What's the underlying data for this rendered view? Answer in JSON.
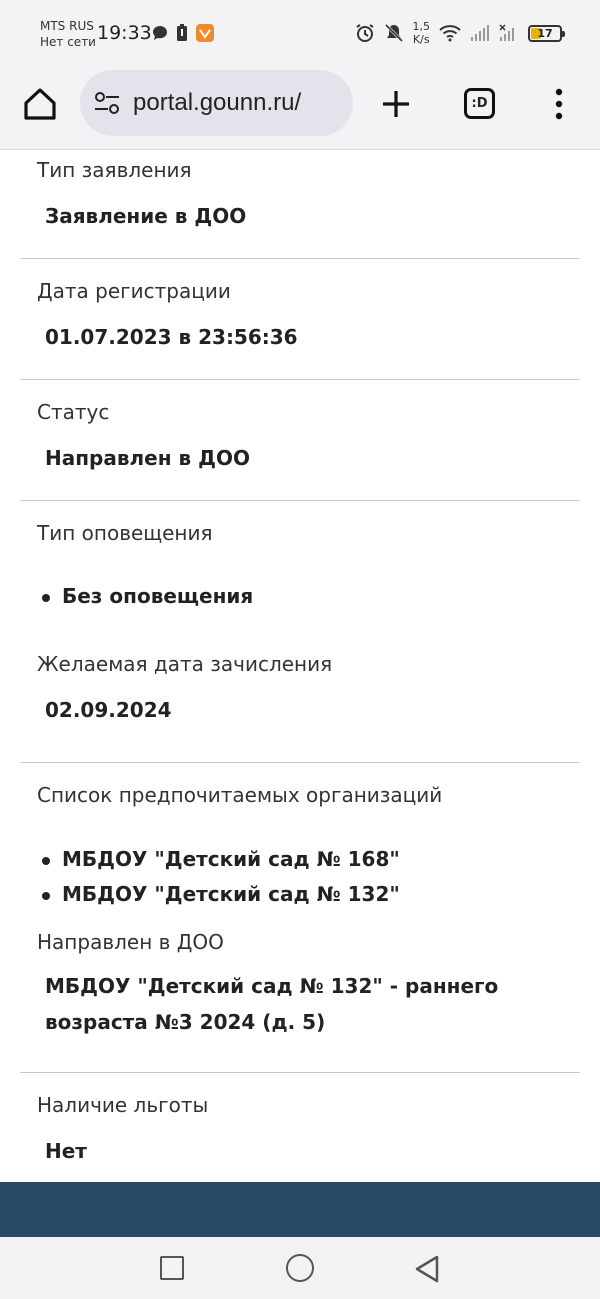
{
  "status_bar": {
    "carrier": "MTS RUS",
    "network": "Нет сети",
    "time": "19:33",
    "speed_value": "1,5",
    "speed_unit": "K/s",
    "battery": "17",
    "icons": [
      "chat-bubble-icon",
      "battery-saver-icon",
      "app-notification-icon",
      "alarm-icon",
      "mute-icon",
      "wifi-icon",
      "signal-icon",
      "signal-no-sim-icon"
    ]
  },
  "browser": {
    "url": "portal.gounn.ru/",
    "tabs_label": ":D",
    "icons": [
      "home-icon",
      "site-settings-icon",
      "new-tab-icon",
      "tabs-icon",
      "menu-icon"
    ]
  },
  "details": {
    "app_type": {
      "label": "Тип заявления",
      "value": "Заявление в ДОО"
    },
    "reg_date": {
      "label": "Дата регистрации",
      "value": "01.07.2023 в 23:56:36"
    },
    "status": {
      "label": "Статус",
      "value": "Направлен в ДОО"
    },
    "notify": {
      "label": "Тип оповещения",
      "items": [
        "Без оповещения"
      ]
    },
    "desired_date": {
      "label": "Желаемая дата зачисления",
      "value": "02.09.2024"
    },
    "orgs": {
      "label": "Список предпочитаемых организаций",
      "items": [
        "МБДОУ \"Детский сад № 168\"",
        "МБДОУ \"Детский сад № 132\""
      ]
    },
    "directed": {
      "label": "Направлен в ДОО",
      "value_line1": "МБДОУ \"Детский сад № 132\" - раннего",
      "value_line2": "возраста №3 2024 (д. 5)"
    },
    "benefit": {
      "label": "Наличие льготы",
      "value": "Нет"
    }
  },
  "colors": {
    "footer_band": "#2a4a63",
    "toolbar_bg": "#f3f3f6",
    "url_pill": "#e3e3ec"
  }
}
